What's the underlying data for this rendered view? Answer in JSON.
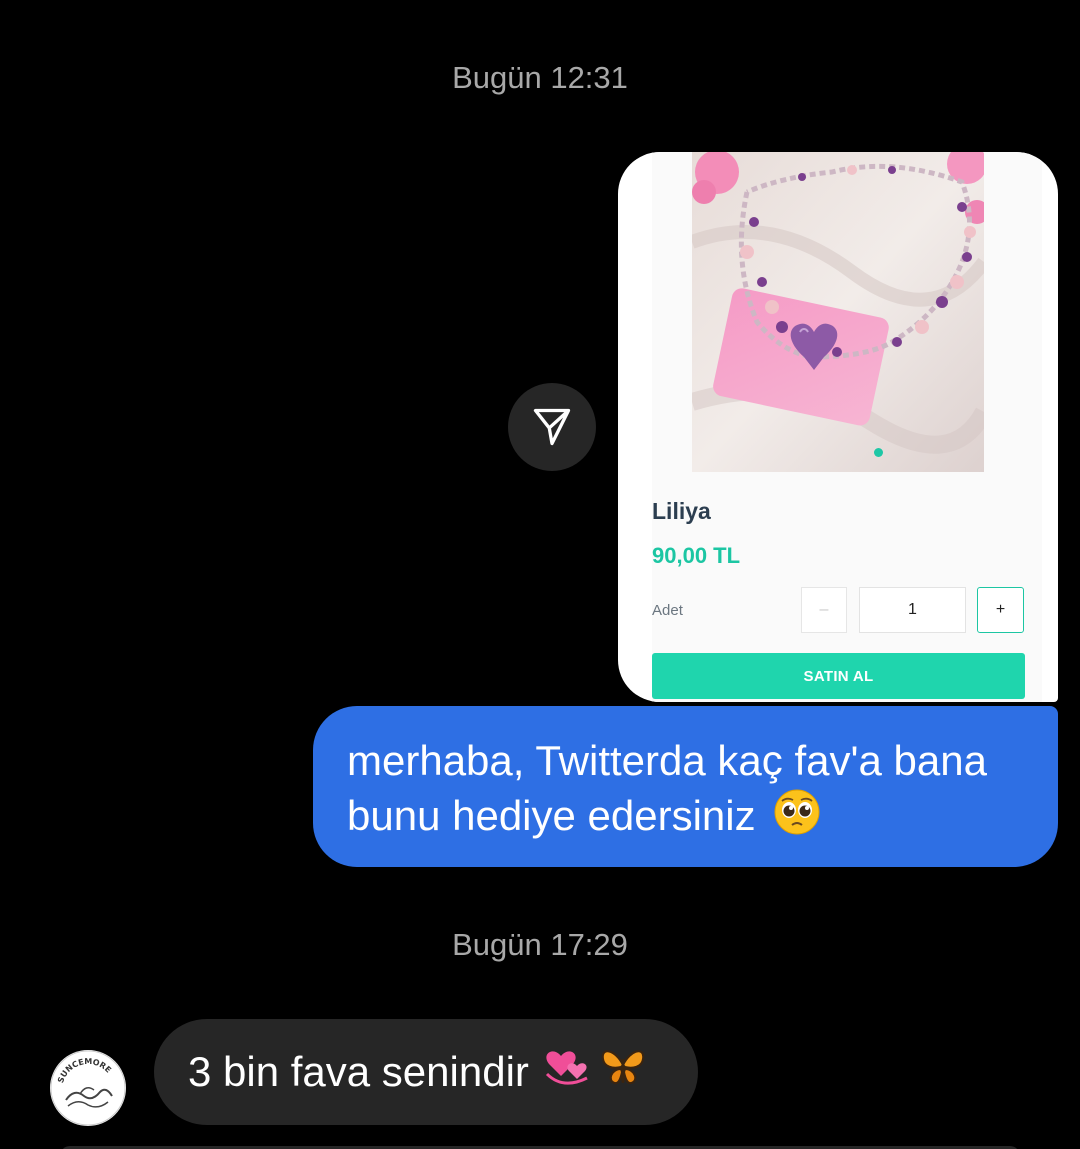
{
  "conversation": {
    "timestamp_1": "Bugün 12:31",
    "timestamp_2": "Bugün 17:29"
  },
  "shared_product": {
    "name": "Liliya",
    "price": "90,00 TL",
    "quantity_label": "Adet",
    "quantity_minus": "–",
    "quantity_value": "1",
    "quantity_plus": "+",
    "buy_button_label": "SATIN AL",
    "accent_color": "#1cc6a3"
  },
  "share_button": {
    "icon": "paper-plane-icon"
  },
  "outgoing_message": {
    "text": "merhaba, Twitterda kaç fav'a bana bunu hediye edersiniz",
    "emoji": "pleading-face-emoji",
    "bubble_color": "#2e6fe4"
  },
  "incoming_message": {
    "text": "3 bin fava senindir",
    "emojis": [
      "revolving-hearts-emoji",
      "butterfly-emoji"
    ],
    "avatar_text": "SUNCEMORE",
    "bubble_color": "#262626"
  }
}
